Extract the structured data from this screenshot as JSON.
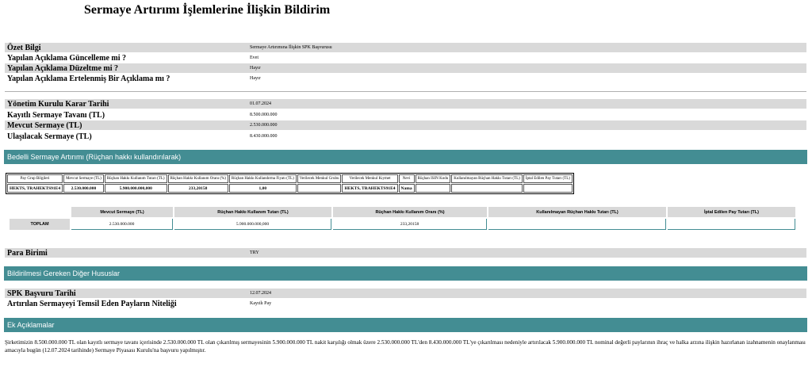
{
  "title": "Sermaye Artırımı İşlemlerine İlişkin Bildirim",
  "summary": [
    {
      "key": "Özet Bilgi",
      "value": "Sermaye Artırımına İlişkin SPK Başvurusu"
    },
    {
      "key": "Yapılan Açıklama Güncelleme mi ?",
      "value": "Evet"
    },
    {
      "key": "Yapılan Açıklama Düzeltme mi ?",
      "value": "Hayır"
    },
    {
      "key": "Yapılan Açıklama Ertelenmiş Bir Açıklama mı ?",
      "value": "Hayır"
    }
  ],
  "board": [
    {
      "key": "Yönetim Kurulu Karar Tarihi",
      "value": "01.07.2024"
    },
    {
      "key": "Kayıtlı Sermaye Tavanı (TL)",
      "value": "8.500.000.000"
    },
    {
      "key": "Mevcut Sermaye (TL)",
      "value": "2.530.000.000"
    },
    {
      "key": "Ulaşılacak Sermaye (TL)",
      "value": "8.430.000.000"
    }
  ],
  "section_rights": "Bedelli Sermaye Artırımı (Rüçhan hakkı kullandırılarak)",
  "detail_table": {
    "headers": [
      "Pay Grup Bilgileri",
      "Mevcut Sermaye (TL)",
      "Rüçhan Hakkı Kullanım Tutarı (TL)",
      "Rüçhan Hakkı Kullanım Oranı (%)",
      "Rüçhan Hakkı Kullandırma Fiyatı (TL)",
      "Verilecek Menkul Grubu",
      "Verilecek Menkul Kıymet",
      "Nevi",
      "Rüçhan ISIN Kodu",
      "Kullanılmayan Rüçhan Hakkı Tutarı (TL)",
      "İptal Edilen Pay Tutarı (TL)"
    ],
    "row": [
      "HEKTS, TRAHEKTS91E4",
      "2.530.000.000",
      "5.900.000.000,000",
      "233,20158",
      "1,00",
      "",
      "HEKTS, TRAHEKTS91E4",
      "Nama",
      "",
      "",
      ""
    ]
  },
  "total_table": {
    "headers": [
      "Mevcut Sermaye (TL)",
      "Rüçhan Hakkı Kullanım Tutarı (TL)",
      "Rüçhan Hakkı Kullanım Oranı (%)",
      "Kullanılmayan Rüçhan Hakkı Tutarı (TL)",
      "İptal Edilen Pay Tutarı (TL)"
    ],
    "label": "TOPLAM",
    "values": [
      "2.530.000.000",
      "5.900.000.000,000",
      "233,20158",
      "",
      ""
    ]
  },
  "currency": {
    "key": "Para Birimi",
    "value": "TRY"
  },
  "section_other": "Bildirilmesi Gereken Diğer Hususlar",
  "other": [
    {
      "key": "SPK Başvuru Tarihi",
      "value": "12.07.2024"
    },
    {
      "key": "Artırılan Sermayeyi Temsil Eden Payların Niteliği",
      "value": "Kayıtlı Pay"
    }
  ],
  "section_notes": "Ek Açıklamalar",
  "notes_text": "Şirketimizin 8.500.000.000 TL olan kayıtlı sermaye tavanı içerisinde 2.530.000.000 TL olan çıkarılmış sermayesinin 5.900.000.000 TL nakit karşılığı olmak üzere 2.530.000.000 TL'den 8.430.000.000 TL'ye çıkarılması nedeniyle artırılacak 5.900.000.000 TL nominal değerli paylarının ihraç ve halka arzına ilişkin hazırlanan izahnamenin onaylanması amacıyla bugün (12.07.2024 tarihinde) Sermaye Piyasası Kurulu'na başvuru yapılmıştır."
}
